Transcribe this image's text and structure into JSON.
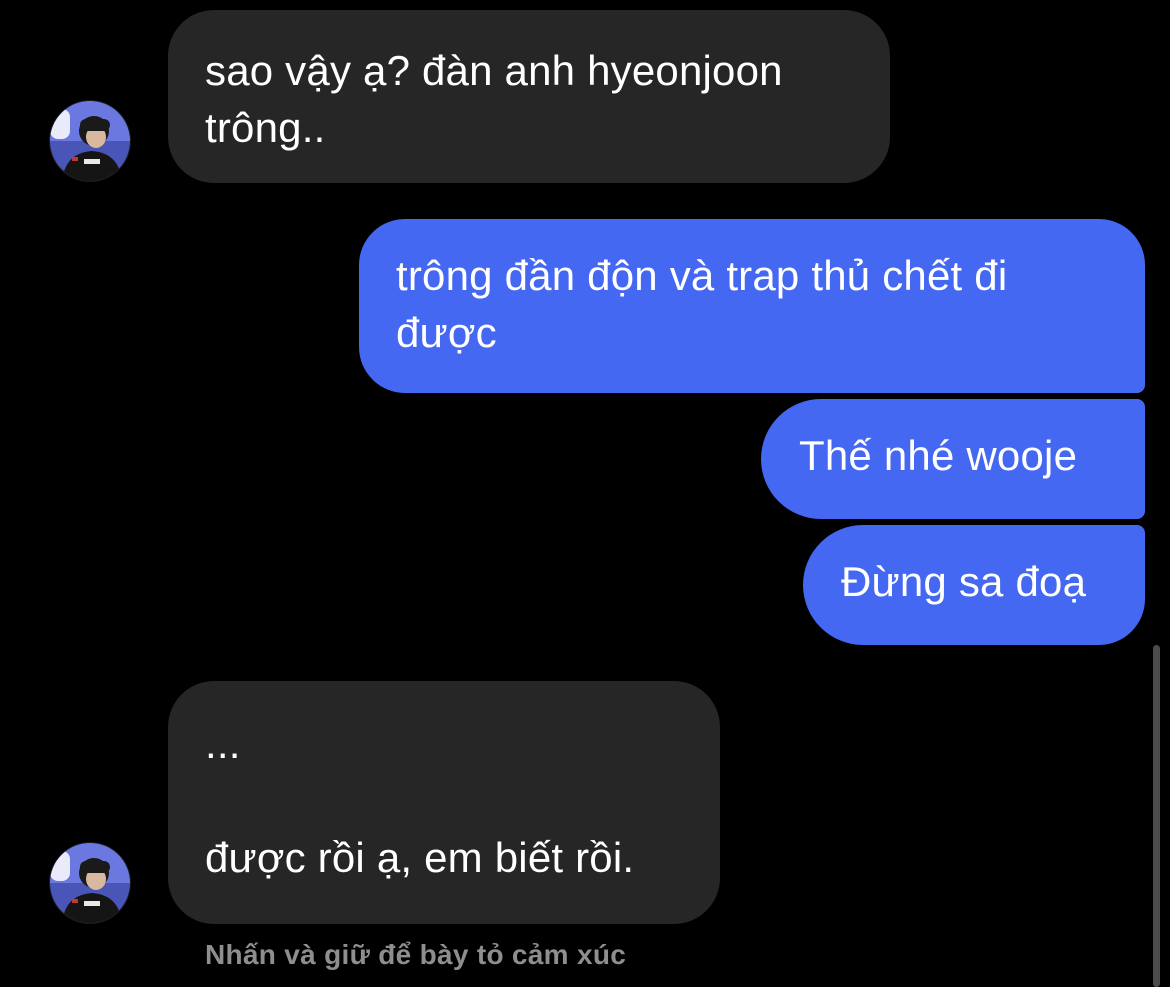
{
  "conversation": {
    "messages": [
      {
        "direction": "incoming",
        "text": "sao vậy ạ? đàn anh hyeonjoon\ntrông.."
      },
      {
        "direction": "outgoing",
        "text": "trông đần độn và trap thủ chết đi\nđược"
      },
      {
        "direction": "outgoing",
        "text": "Thế nhé wooje"
      },
      {
        "direction": "outgoing",
        "text": "Đừng sa đoạ"
      },
      {
        "direction": "incoming",
        "text": "...\n\nđược rồi ạ, em biết rồi."
      }
    ],
    "reaction_hint": "Nhấn và giữ để bày tỏ cảm xúc"
  },
  "theme": {
    "background": "#000000",
    "incoming_bubble": "#262626",
    "outgoing_bubble": "#4468F1",
    "hint_text": "#8E8E8E"
  },
  "icons": {
    "avatar": "contact-avatar-photo"
  }
}
